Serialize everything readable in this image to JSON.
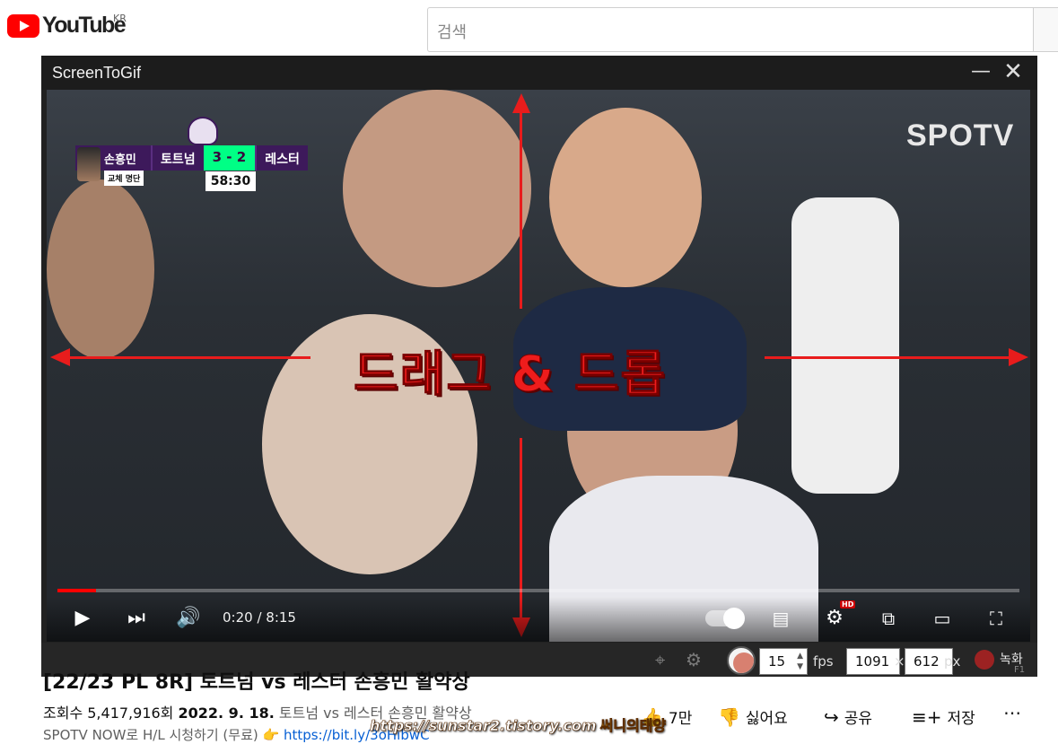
{
  "youtube": {
    "logo_text": "YouTube",
    "country": "KR",
    "search_placeholder": "검색"
  },
  "screentogif": {
    "window_title": "ScreenToGif",
    "minimize_glyph": "—",
    "close_glyph": "✕",
    "fps_value": "15",
    "fps_label": "fps",
    "width_value": "1091",
    "times": "×",
    "height_value": "612",
    "px_label": "px",
    "record_label": "녹화",
    "record_shortcut": "F1"
  },
  "video": {
    "broadcaster": "SPOTV",
    "overlay_text": "드래그 & 드롭",
    "scoreboard": {
      "player": "손흥민",
      "player_sub": "교체 명단",
      "home": "토트넘",
      "score": "3 - 2",
      "away": "레스터",
      "clock": "58:30"
    },
    "time_display": "0:20 / 8:15",
    "progress_fraction": 0.04,
    "hd_badge": "HD"
  },
  "info": {
    "title": "[22/23 PL 8R] 토트넘 vs 레스터 손흥민 활약상",
    "views": "조회수 5,417,916회",
    "date": "2022. 9. 18.",
    "desc_inline": "토트넘 vs 레스터 손흥민 활약상",
    "desc_line2": "SPOTV NOW로 H/L 시청하기 (무료) 👉",
    "desc_link": "https://bit.ly/3oHibwC",
    "likes": "7만",
    "dislike": "싫어요",
    "share": "공유",
    "save": "저장",
    "more": "⋯"
  },
  "watermark": {
    "url": "https://sunstar2.tistory.com",
    "brand": "써니의태양"
  },
  "colors": {
    "youtube_red": "#ff0000",
    "arrow_red": "#e81c1c",
    "link_blue": "#065fd4"
  }
}
